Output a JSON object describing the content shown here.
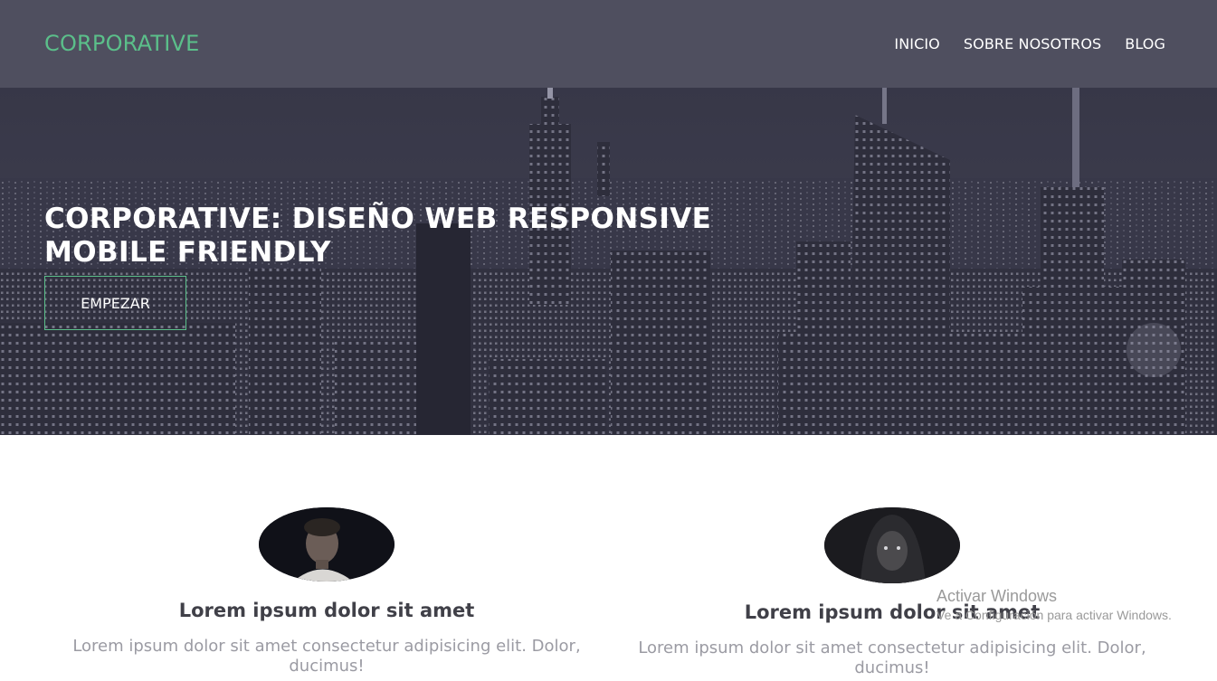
{
  "navbar": {
    "brand": "CORPORATIVE",
    "links": [
      "INICIO",
      "SOBRE NOSOTROS",
      "BLOG"
    ]
  },
  "hero": {
    "title_strong": "CORPORATIVE:",
    "title_rest": "DISEÑO WEB RESPONSIVE MOBILE FRIENDLY",
    "cta_label": "EMPEZAR"
  },
  "features": [
    {
      "title": "Lorem ipsum dolor sit amet",
      "text": "Lorem ipsum dolor sit amet consectetur adipisicing elit. Dolor, ducimus!"
    },
    {
      "title": "Lorem ipsum dolor sit amet",
      "text": "Lorem ipsum dolor sit amet consectetur adipisicing elit. Dolor, ducimus!"
    }
  ],
  "watermark": {
    "title": "Activar Windows",
    "subtitle": "Ve a Configuración para activar Windows."
  },
  "colors": {
    "navbar_bg": "#4f4f5f",
    "accent": "#5bbf8a",
    "heading": "#404048",
    "body_text": "#9b9ba3"
  }
}
